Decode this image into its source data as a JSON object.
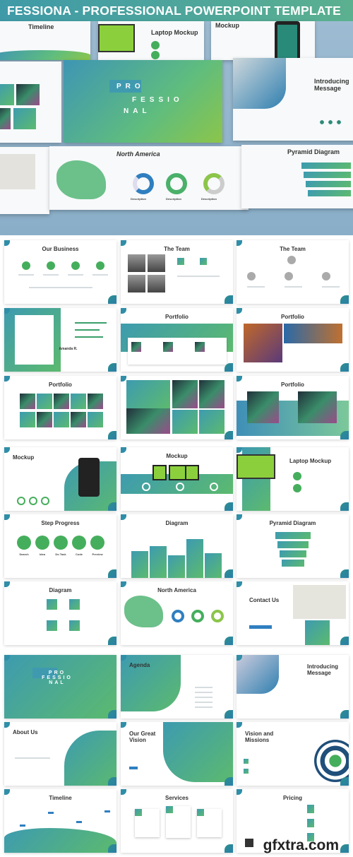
{
  "header": {
    "title": "FESSIONA - PROFESSIONAL POWERPOINT TEMPLATE"
  },
  "hero": {
    "timeline": "Timeline",
    "laptop": "Laptop Mockup",
    "mockup": "Mockup",
    "pro": [
      "PRO",
      "FESSIO",
      "NAL"
    ],
    "intro": "Introducing Message",
    "north": "North America",
    "pyramid": "Pyramid Diagram",
    "description": "Description"
  },
  "slides": [
    {
      "title": "Our Business",
      "kind": "icons4"
    },
    {
      "title": "The Team",
      "kind": "team"
    },
    {
      "title": "The Team",
      "kind": "org"
    },
    {
      "title": "Amanda R.",
      "kind": "profile"
    },
    {
      "title": "Portfolio",
      "kind": "band"
    },
    {
      "title": "Portfolio",
      "kind": "photos2"
    },
    {
      "title": "Portfolio",
      "kind": "grid10"
    },
    {
      "title": "",
      "kind": "greenphotos"
    },
    {
      "title": "Portfolio",
      "kind": "photos2band"
    },
    {
      "title": "Mockup",
      "kind": "phone"
    },
    {
      "title": "Mockup",
      "kind": "tablets"
    },
    {
      "title": "Laptop Mockup",
      "kind": "laptop"
    },
    {
      "title": "Step Progress",
      "kind": "steps",
      "labels": [
        "Search",
        "Idea",
        "Do Task",
        "Code",
        "Preview"
      ]
    },
    {
      "title": "Diagram",
      "kind": "bars"
    },
    {
      "title": "Pyramid Diagram",
      "kind": "pyramid"
    },
    {
      "title": "Diagram",
      "kind": "icons4grid"
    },
    {
      "title": "North America",
      "kind": "map"
    },
    {
      "title": "Contact Us",
      "kind": "contact"
    },
    {
      "title": "PRO FESSIO NAL",
      "kind": "cover"
    },
    {
      "title": "Agenda",
      "kind": "agenda"
    },
    {
      "title": "Introducing Message",
      "kind": "intro"
    },
    {
      "title": "About Us",
      "kind": "about"
    },
    {
      "title": "Our Great Vision",
      "kind": "vision"
    },
    {
      "title": "Vision and Missions",
      "kind": "target"
    },
    {
      "title": "Timeline",
      "kind": "wave"
    },
    {
      "title": "Services",
      "kind": "cards"
    },
    {
      "title": "Pricing",
      "kind": "pricing"
    }
  ],
  "watermark": "gfxtra.com",
  "colors": {
    "green": "#45ae5c",
    "teal": "#2f8ea8",
    "banner": "#3f9aa8"
  }
}
